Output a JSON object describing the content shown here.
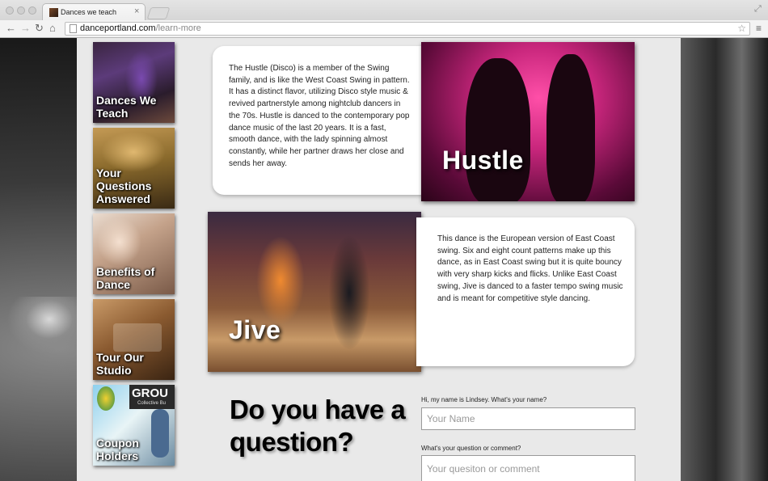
{
  "browser": {
    "tab_title": "Dances we teach",
    "url_host": "danceportland.com",
    "url_path": "/learn-more",
    "icons": [
      "back-icon",
      "forward-icon",
      "reload-icon",
      "home-icon",
      "star-icon",
      "menu-icon"
    ]
  },
  "nav": {
    "items": [
      {
        "label": "Dances We\nTeach"
      },
      {
        "label": "Your\nQuestions\nAnswered"
      },
      {
        "label": "Benefits of\nDance"
      },
      {
        "label": "Tour Our\nStudio"
      },
      {
        "label": "Coupon\nHolders"
      }
    ],
    "groupon_text": "GROU",
    "groupon_sub": "Collective Bu"
  },
  "dances": [
    {
      "name": "Hustle",
      "description": "The Hustle (Disco) is a member of the Swing family, and is like the West Coast Swing in pattern. It has a distinct flavor, utilizing Disco style music & revived partnerstyle among nightclub dancers in the 70s. Hustle is danced to the contemporary pop dance music of the last 20 years. It is a fast, smooth dance, with the lady spinning almost constantly, while her partner draws her close and sends her away."
    },
    {
      "name": "Jive",
      "description": "This dance is the European version of East Coast swing. Six and eight count patterns make up this dance, as in East Coast swing but it is quite bouncy with very sharp kicks and flicks. Unlike East Coast swing, Jive is danced to a faster tempo swing music and is meant for competitive style dancing."
    }
  ],
  "question": {
    "heading": "Do you have a question?",
    "name_label": "Hi, my name is Lindsey. What's your name?",
    "name_placeholder": "Your Name",
    "comment_label": "What's your question or comment?",
    "comment_placeholder": "Your quesiton or comment"
  }
}
